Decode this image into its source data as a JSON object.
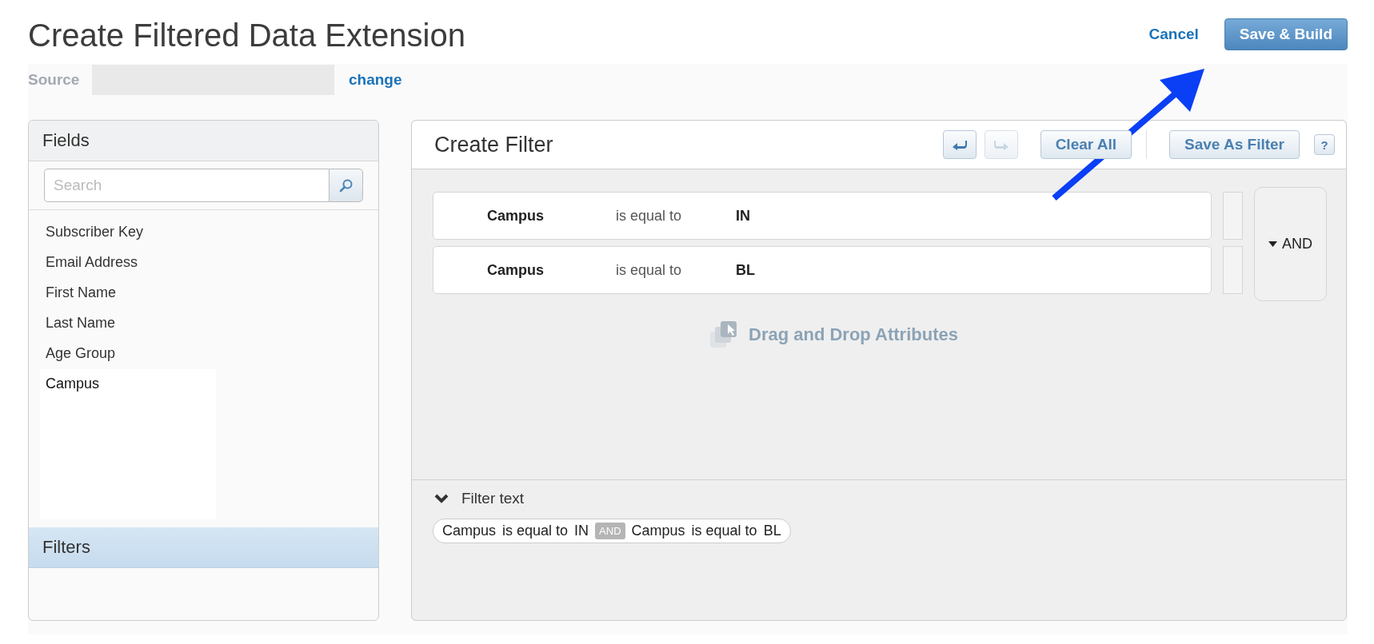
{
  "page": {
    "title": "Create Filtered Data Extension",
    "cancel": "Cancel",
    "save_build": "Save & Build"
  },
  "source": {
    "label": "Source",
    "change": "change"
  },
  "fields_panel": {
    "title": "Fields",
    "highlighted": false,
    "search": {
      "placeholder": "Search"
    },
    "items": [
      {
        "label": "Subscriber Key",
        "selected": false
      },
      {
        "label": "Email Address",
        "selected": false
      },
      {
        "label": "First Name",
        "selected": false
      },
      {
        "label": "Last Name",
        "selected": false
      },
      {
        "label": "Age Group",
        "selected": false
      },
      {
        "label": "Campus",
        "selected": true
      }
    ]
  },
  "filters_panel": {
    "title": "Filters",
    "highlighted": true
  },
  "filter_editor": {
    "title": "Create Filter",
    "toolbar": [
      {
        "kind": "undo",
        "disabled": false
      },
      {
        "kind": "redo",
        "disabled": true
      },
      {
        "kind": "text",
        "label": "Clear All",
        "disabled": false
      },
      {
        "kind": "divider"
      },
      {
        "kind": "text",
        "label": "Save As Filter",
        "disabled": false
      },
      {
        "kind": "help",
        "label": "?",
        "disabled": false
      }
    ],
    "conditions": [
      {
        "field": "Campus",
        "operator": "is equal to",
        "value": "IN"
      },
      {
        "field": "Campus",
        "operator": "is equal to",
        "value": "BL"
      }
    ],
    "logic": {
      "label": "AND",
      "kind": "dropdown"
    },
    "drop_hint": "Drag and Drop Attributes",
    "filter_text": {
      "title": "Filter text",
      "expanded": true,
      "segments": [
        {
          "kind": "text",
          "text": "Campus"
        },
        {
          "kind": "text",
          "text": "is equal to"
        },
        {
          "kind": "text",
          "text": "IN"
        },
        {
          "kind": "joiner",
          "text": "AND"
        },
        {
          "kind": "text",
          "text": "Campus"
        },
        {
          "kind": "text",
          "text": "is equal to"
        },
        {
          "kind": "text",
          "text": "BL"
        }
      ]
    }
  }
}
